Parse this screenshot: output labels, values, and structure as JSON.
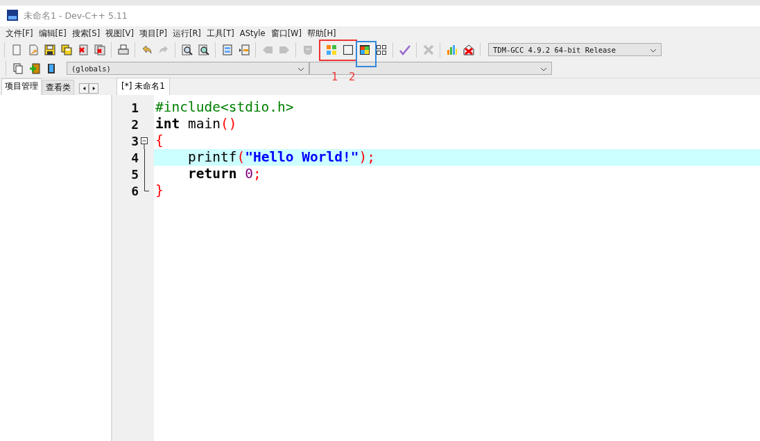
{
  "window": {
    "title": "未命名1 - Dev-C++ 5.11"
  },
  "menu": [
    "文件[F]",
    "编辑[E]",
    "搜索[S]",
    "视图[V]",
    "项目[P]",
    "运行[R]",
    "工具[T]",
    "AStyle",
    "窗口[W]",
    "帮助[H]"
  ],
  "toolbar": [
    [
      {
        "kind": "new",
        "disabled": false
      },
      {
        "kind": "open",
        "disabled": false
      },
      {
        "kind": "save",
        "disabled": false
      },
      {
        "kind": "saveall",
        "disabled": false
      },
      {
        "kind": "close",
        "disabled": false
      },
      {
        "kind": "closeall",
        "disabled": false
      }
    ],
    [
      {
        "kind": "print",
        "disabled": false
      }
    ],
    [
      {
        "kind": "undo",
        "disabled": false
      },
      {
        "kind": "redo",
        "disabled": true
      }
    ],
    [
      {
        "kind": "find",
        "disabled": false
      },
      {
        "kind": "replace",
        "disabled": false
      }
    ],
    [
      {
        "kind": "indent",
        "disabled": false
      },
      {
        "kind": "unindent",
        "disabled": false
      }
    ],
    [
      {
        "kind": "back",
        "disabled": true
      },
      {
        "kind": "forward",
        "disabled": true
      }
    ],
    [
      {
        "kind": "bookmark",
        "disabled": true
      }
    ],
    [
      {
        "kind": "tiles",
        "disabled": false
      },
      {
        "kind": "window",
        "disabled": false
      },
      {
        "kind": "colorwin",
        "disabled": false
      },
      {
        "kind": "grid",
        "disabled": false
      }
    ],
    [
      {
        "kind": "check",
        "disabled": false
      }
    ],
    [
      {
        "kind": "cross",
        "disabled": true
      }
    ],
    [
      {
        "kind": "chart",
        "disabled": false
      },
      {
        "kind": "delete",
        "disabled": false
      }
    ]
  ],
  "compiler": {
    "value": "TDM-GCC 4.9.2 64-bit Release"
  },
  "toolbar2": [
    {
      "kind": "project",
      "disabled": false
    },
    {
      "kind": "add",
      "disabled": false
    },
    {
      "kind": "book",
      "disabled": false
    }
  ],
  "scope": {
    "value": "(globals)"
  },
  "annotations": [
    {
      "label": "1",
      "color": "#ee3333"
    },
    {
      "label": "2",
      "color": "#3388dd"
    }
  ],
  "side_tabs": [
    {
      "label": "项目管理",
      "selected": true
    },
    {
      "label": "查看类",
      "selected": false
    }
  ],
  "editor_tabs": [
    {
      "label": "[*] 未命名1",
      "selected": true
    }
  ],
  "code": [
    {
      "number": "1",
      "kind": "plain",
      "current": false,
      "tokens": [
        {
          "text": "#include<stdio.h>",
          "kind": "preproc"
        }
      ]
    },
    {
      "number": "2",
      "kind": "plain",
      "current": false,
      "tokens": [
        {
          "text": "int",
          "kind": "keyword"
        },
        {
          "text": " main",
          "kind": "plain"
        },
        {
          "text": "()",
          "kind": "symbol"
        }
      ]
    },
    {
      "number": "3",
      "kind": "fold-start",
      "current": false,
      "tokens": [
        {
          "text": "{",
          "kind": "symbol"
        }
      ]
    },
    {
      "number": "4",
      "kind": "fold-line",
      "current": true,
      "tokens": [
        {
          "text": "    printf",
          "kind": "plain"
        },
        {
          "text": "(",
          "kind": "symbol"
        },
        {
          "text": "\"Hello World!\"",
          "kind": "string"
        },
        {
          "text": ");",
          "kind": "symbol"
        }
      ]
    },
    {
      "number": "5",
      "kind": "fold-line",
      "current": false,
      "tokens": [
        {
          "text": "    return ",
          "kind": "keyword"
        },
        {
          "text": "0",
          "kind": "number"
        },
        {
          "text": ";",
          "kind": "symbol"
        }
      ]
    },
    {
      "number": "6",
      "kind": "fold-end",
      "current": false,
      "tokens": [
        {
          "text": "}",
          "kind": "symbol"
        }
      ]
    }
  ]
}
